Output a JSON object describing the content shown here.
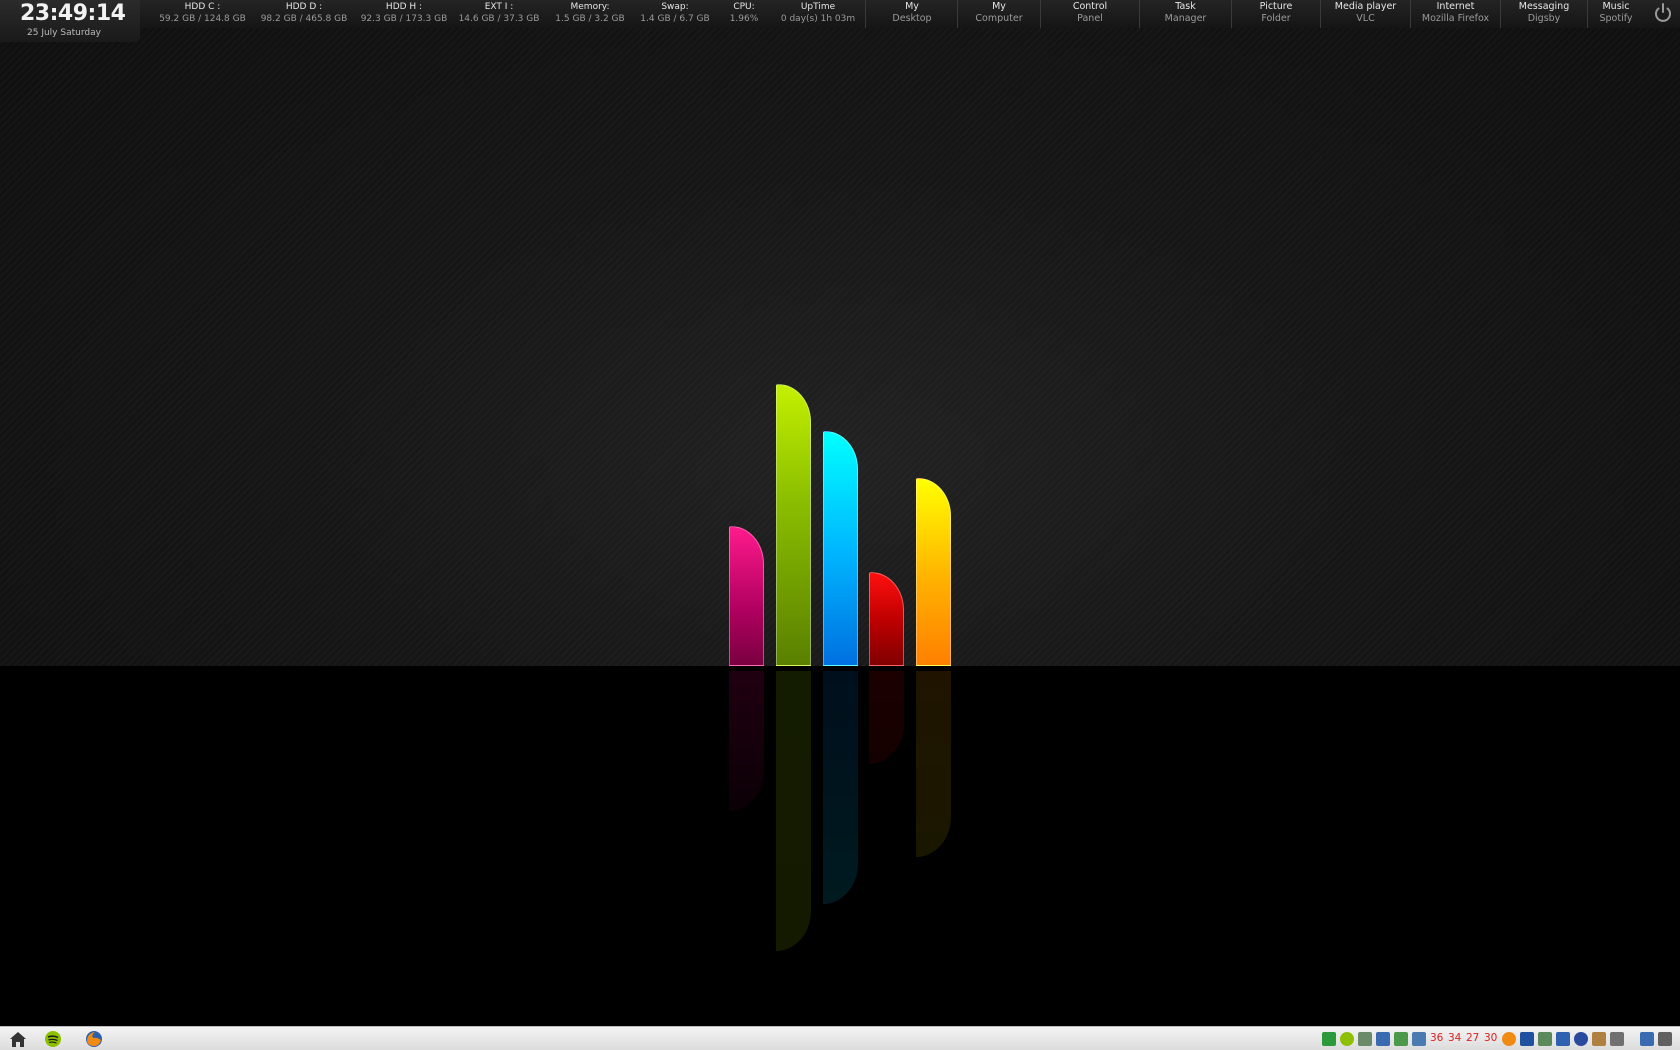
{
  "clock": {
    "time": "23:49:14",
    "date": "25 July Saturday"
  },
  "stats": [
    {
      "label": "HDD C :",
      "value": "59.2 GB  / 124.8 GB"
    },
    {
      "label": "HDD D :",
      "value": "98.2 GB  / 465.8 GB"
    },
    {
      "label": "HDD H :",
      "value": "92.3 GB  / 173.3 GB"
    },
    {
      "label": "EXT I :",
      "value": "14.6 GB  / 37.3 GB"
    },
    {
      "label": "Memory:",
      "value": "1.5 GB  / 3.2 GB"
    },
    {
      "label": "Swap:",
      "value": "1.4 GB  / 6.7 GB"
    },
    {
      "label": "CPU:",
      "value": "1.96%"
    },
    {
      "label": "UpTime",
      "value": "0 day(s) 1h 03m"
    }
  ],
  "shortcuts": [
    {
      "line1": "My",
      "line2": "Desktop"
    },
    {
      "line1": "My",
      "line2": "Computer"
    },
    {
      "line1": "Control",
      "line2": "Panel"
    },
    {
      "line1": "Task",
      "line2": "Manager"
    },
    {
      "line1": "Picture",
      "line2": "Folder"
    },
    {
      "line1": "Media player",
      "line2": "VLC"
    },
    {
      "line1": "Internet",
      "line2": "Mozilla Firefox"
    },
    {
      "line1": "Messaging",
      "line2": "Digsby"
    },
    {
      "line1": "Music",
      "line2": "Spotify"
    }
  ],
  "power_icon": "power-icon",
  "logo_colors": [
    "#e0106f",
    "#a4d400",
    "#00d8ff",
    "#e01010",
    "#ffb000"
  ],
  "taskbar": {
    "pinned": [
      "home-icon",
      "spotify-icon",
      "firefox-icon"
    ],
    "tray_numbers": [
      "36",
      "34",
      "27",
      "30"
    ]
  }
}
